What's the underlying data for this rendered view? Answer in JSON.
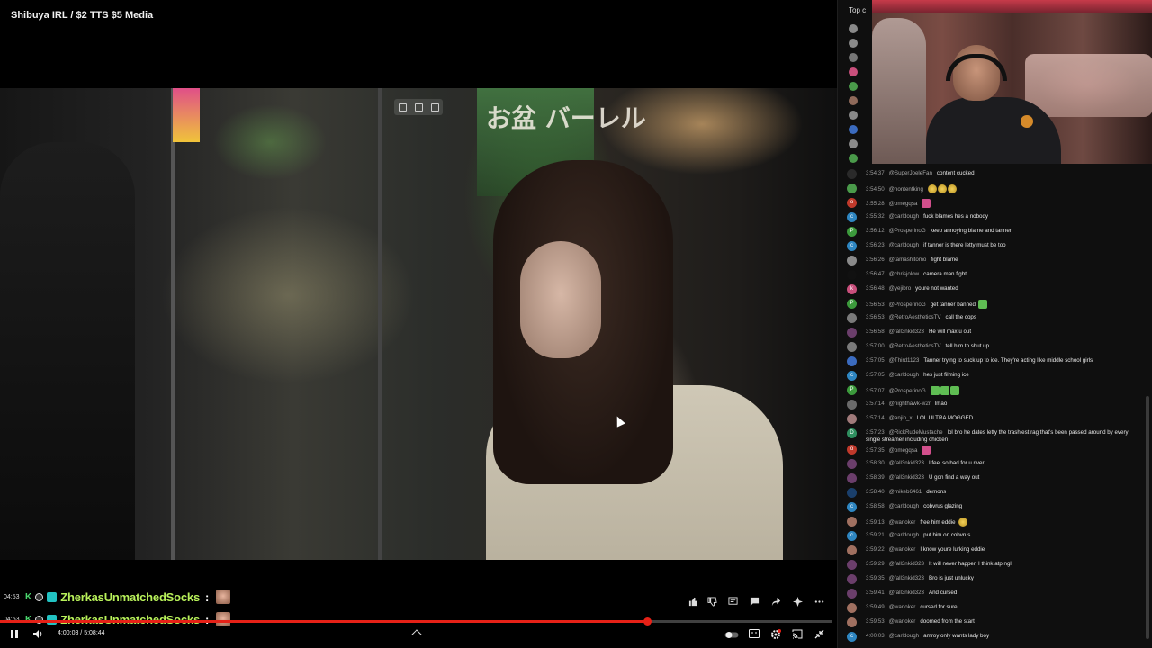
{
  "video": {
    "title": "Shibuya IRL / $2 TTS $5 Media",
    "sign_text": "お盆 バーレル",
    "time_display": "4:00:03 / 5:08:44",
    "progress_fraction": 0.778
  },
  "tts": [
    {
      "time": "04:53",
      "name": "ZherkasUnmatchedSocks",
      "colon": ":"
    },
    {
      "time": "04:53",
      "name": "ZherkasUnmatchedSocks",
      "colon": ":"
    }
  ],
  "controls": {
    "play_pause_icon": "pause-icon",
    "volume_icon": "volume-icon",
    "action_icons": [
      "like-icon",
      "dislike-icon",
      "chat-icon",
      "comment-icon",
      "share-icon",
      "sparkle-icon",
      "more-icon"
    ],
    "right_icons": [
      "autoplay-toggle-icon",
      "captions-icon",
      "settings-icon",
      "cast-icon",
      "exit-fullscreen-icon"
    ]
  },
  "chat": {
    "top_label": "Top c",
    "viewer_colors": [
      "#8a8a8a",
      "#8a8a8a",
      "#777777",
      "#c94f7c",
      "#4a9a4a",
      "#8f6a5a",
      "#8a8a8a",
      "#3b6bbf",
      "#8a8a8a",
      "#4a9a4a"
    ],
    "messages": [
      {
        "time": "3:54:37",
        "author": "@SuperJoeleFan",
        "text": "content cucked",
        "avatar_color": "#2a2a2a",
        "avatar_letter": "",
        "emotes": []
      },
      {
        "time": "3:54:50",
        "author": "@nontentking",
        "text": "",
        "avatar_color": "#4a9a4a",
        "avatar_letter": "",
        "emotes": [
          "face",
          "face",
          "face"
        ]
      },
      {
        "time": "3:55:28",
        "author": "@omegqsa",
        "text": "",
        "avatar_color": "#c0392b",
        "avatar_letter": "o",
        "emotes": [
          "pink"
        ]
      },
      {
        "time": "3:55:32",
        "author": "@carldough",
        "text": "fuck blames hes a nobody",
        "avatar_color": "#2e86c1",
        "avatar_letter": "c",
        "emotes": []
      },
      {
        "time": "3:56:12",
        "author": "@ProsperinoG",
        "text": "keep annoying blame and tanner",
        "avatar_color": "#3c9a3c",
        "avatar_letter": "P",
        "emotes": []
      },
      {
        "time": "3:56:23",
        "author": "@carldough",
        "text": "if tanner is there letty must be too",
        "avatar_color": "#2e86c1",
        "avatar_letter": "c",
        "emotes": []
      },
      {
        "time": "3:56:26",
        "author": "@tamashitomo",
        "text": "fight blame",
        "avatar_color": "#8a8a8a",
        "avatar_letter": "",
        "emotes": []
      },
      {
        "time": "3:56:47",
        "author": "@chrisjolow",
        "text": "camera man fight",
        "avatar_color": "#111111",
        "avatar_letter": "",
        "emotes": []
      },
      {
        "time": "3:56:48",
        "author": "@yejibro",
        "text": "youre not wanted",
        "avatar_color": "#c94f7c",
        "avatar_letter": "k",
        "emotes": []
      },
      {
        "time": "3:56:53",
        "author": "@ProsperinoG",
        "text": "get tanner banned",
        "avatar_color": "#3c9a3c",
        "avatar_letter": "P",
        "emotes": [
          "green"
        ]
      },
      {
        "time": "3:56:53",
        "author": "@RetroAestheticsTV",
        "text": "call the cops",
        "avatar_color": "#7a7a7a",
        "avatar_letter": "",
        "emotes": []
      },
      {
        "time": "3:56:58",
        "author": "@fall3nkid323",
        "text": "He will max u out",
        "avatar_color": "#6b3e6b",
        "avatar_letter": "",
        "emotes": []
      },
      {
        "time": "3:57:00",
        "author": "@RetroAestheticsTV",
        "text": "tell him to shut up",
        "avatar_color": "#7a7a7a",
        "avatar_letter": "",
        "emotes": []
      },
      {
        "time": "3:57:05",
        "author": "@Third1123",
        "text": "Tanner trying to suck up to ice. They're acting like middle school girls",
        "avatar_color": "#3b6bbf",
        "avatar_letter": "",
        "emotes": []
      },
      {
        "time": "3:57:05",
        "author": "@carldough",
        "text": "hes just filming ice",
        "avatar_color": "#2e86c1",
        "avatar_letter": "c",
        "emotes": []
      },
      {
        "time": "3:57:07",
        "author": "@ProsperinoG",
        "text": "",
        "avatar_color": "#3c9a3c",
        "avatar_letter": "P",
        "emotes": [
          "green",
          "green",
          "green"
        ]
      },
      {
        "time": "3:57:14",
        "author": "@nighthawk-w2r",
        "text": "lmao",
        "avatar_color": "#6a6a6a",
        "avatar_letter": "",
        "emotes": []
      },
      {
        "time": "3:57:14",
        "author": "@anjin_x",
        "text": "LOL ULTRA MOGGED",
        "avatar_color": "#a07a7a",
        "avatar_letter": "",
        "emotes": []
      },
      {
        "time": "3:57:23",
        "author": "@RickRudeMustache",
        "text": "lol bro he dates letty the trashiest rag that's been passed around by every single streamer including chicken",
        "avatar_color": "#2f8f5f",
        "avatar_letter": "D",
        "emotes": []
      },
      {
        "time": "3:57:35",
        "author": "@omegqsa",
        "text": "",
        "avatar_color": "#c0392b",
        "avatar_letter": "o",
        "emotes": [
          "pink"
        ]
      },
      {
        "time": "3:58:30",
        "author": "@fall3nkid323",
        "text": "I feel so bad for u river",
        "avatar_color": "#6b3e6b",
        "avatar_letter": "",
        "emotes": []
      },
      {
        "time": "3:58:39",
        "author": "@fall3nkid323",
        "text": "U gon find a way out",
        "avatar_color": "#6b3e6b",
        "avatar_letter": "",
        "emotes": []
      },
      {
        "time": "3:58:40",
        "author": "@mikeb6461",
        "text": "demons",
        "avatar_color": "#1a3f6b",
        "avatar_letter": "",
        "emotes": []
      },
      {
        "time": "3:58:58",
        "author": "@carldough",
        "text": "cobvrus glazing",
        "avatar_color": "#2e86c1",
        "avatar_letter": "c",
        "emotes": []
      },
      {
        "time": "3:59:13",
        "author": "@wanoker",
        "text": "free him eddie",
        "avatar_color": "#a07060",
        "avatar_letter": "",
        "emotes": [
          "face"
        ]
      },
      {
        "time": "3:59:21",
        "author": "@carldough",
        "text": "put him on cobvrus",
        "avatar_color": "#2e86c1",
        "avatar_letter": "c",
        "emotes": []
      },
      {
        "time": "3:59:22",
        "author": "@wanoker",
        "text": "I know youre lurking eddie",
        "avatar_color": "#a07060",
        "avatar_letter": "",
        "emotes": []
      },
      {
        "time": "3:59:29",
        "author": "@fall3nkid323",
        "text": "It will never happen I think atp ngl",
        "avatar_color": "#6b3e6b",
        "avatar_letter": "",
        "emotes": []
      },
      {
        "time": "3:59:35",
        "author": "@fall3nkid323",
        "text": "Bro is just unlucky",
        "avatar_color": "#6b3e6b",
        "avatar_letter": "",
        "emotes": []
      },
      {
        "time": "3:59:41",
        "author": "@fall3nkid323",
        "text": "And cursed",
        "avatar_color": "#6b3e6b",
        "avatar_letter": "",
        "emotes": []
      },
      {
        "time": "3:59:49",
        "author": "@wanoker",
        "text": "cursed for sure",
        "avatar_color": "#a07060",
        "avatar_letter": "",
        "emotes": []
      },
      {
        "time": "3:59:53",
        "author": "@wanoker",
        "text": "doomed from the start",
        "avatar_color": "#a07060",
        "avatar_letter": "",
        "emotes": []
      },
      {
        "time": "4:00:03",
        "author": "@carldough",
        "text": "amroy only wants lady boy",
        "avatar_color": "#2e86c1",
        "avatar_letter": "c",
        "emotes": []
      }
    ]
  }
}
